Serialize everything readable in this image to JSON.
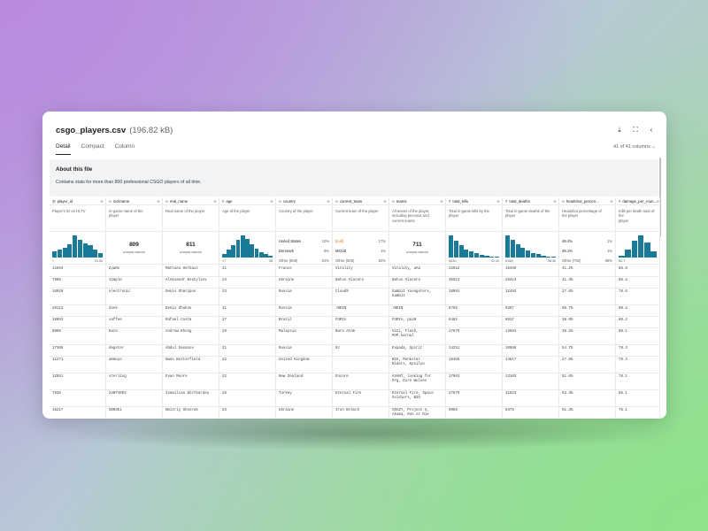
{
  "window": {
    "title": "csgo_players.csv",
    "size": "(196.82 kB)",
    "tabs": [
      "Detail",
      "Compact",
      "Column"
    ],
    "columns_info": "41 of 41 columns",
    "about_title": "About this file",
    "about_text": "Contains stats for more than 800 professional CSGO players of all time."
  },
  "colors": {
    "bar": "#1a7a97",
    "orange": "#e8710a"
  },
  "columns": [
    {
      "type_icon": "⊞",
      "name": "player_id",
      "desc": [
        "Player's ID on HLTV"
      ],
      "viz": "hist",
      "hist": [
        0.3,
        0.35,
        0.45,
        0.6,
        1.0,
        0.8,
        0.65,
        0.55,
        0.35,
        0.2
      ],
      "min": "7",
      "max": "20.5k",
      "cells": [
        "11893",
        "7998",
        "16920",
        "20113",
        "18053",
        "8098",
        "17306",
        "11271",
        "12951",
        "7938",
        "18217"
      ]
    },
    {
      "type_icon": "A",
      "name": "nickname",
      "desc": [
        "In-game name of the",
        "player"
      ],
      "viz": "unique",
      "unique_n": "809",
      "unique_label": "unique values",
      "cells": [
        "ZywOo",
        "s1mple",
        "electronic",
        "donk",
        "saffee",
        "Kaze",
        "degster",
        "ammoyo",
        "sterling",
        "XANTARES",
        "SENSEi"
      ]
    },
    {
      "type_icon": "A",
      "name": "real_name",
      "desc": [
        "Real name of the player"
      ],
      "viz": "unique",
      "unique_n": "811",
      "unique_label": "unique values",
      "cells": [
        "Mathieu Herbaut",
        "Aleksandr Kostyliev",
        "Denis Sharipov",
        "Denis Zhukov",
        "Rafael Costa",
        "Andrew Khong",
        "Abdul Gasanov",
        "Owen Butterfield",
        "Evan Moore",
        "İsmailcan Dörtkardeş",
        "Dmitriy Shvorak"
      ]
    },
    {
      "type_icon": "#",
      "name": "age",
      "desc": [
        "Age of the player"
      ],
      "viz": "hist",
      "hist": [
        0.15,
        0.35,
        0.55,
        0.8,
        1.0,
        0.85,
        0.6,
        0.4,
        0.25,
        0.15,
        0.08
      ],
      "min": "17",
      "max": "38",
      "cells": [
        "21",
        "24",
        "23",
        "21",
        "27",
        "29",
        "21",
        "22",
        "22",
        "26",
        "23"
      ]
    },
    {
      "type_icon": "A",
      "name": "country",
      "desc": [
        "Country of the player"
      ],
      "viz": "cats",
      "cats": [
        {
          "label": "United States",
          "pct": "10%"
        },
        {
          "label": "Denmark",
          "pct": "8%"
        },
        {
          "label": "Other (658)",
          "pct": "81%",
          "other": true
        }
      ],
      "cells": [
        "France",
        "Ukraine",
        "Russia",
        "Russia",
        "Brazil",
        "Malaysia",
        "Russia",
        "United Kingdom",
        "New Zealand",
        "Turkey",
        "Ukraine"
      ]
    },
    {
      "type_icon": "A",
      "name": "current_team",
      "desc": [
        "Current team of the player"
      ],
      "viz": "cats",
      "cats": [
        {
          "label": "[null]",
          "pct": "17%",
          "orange": true
        },
        {
          "label": "MOUZ",
          "pct": "1%"
        },
        {
          "label": "Other (509)",
          "pct": "82%",
          "other": true
        }
      ],
      "cells": [
        "Vitality",
        "Natus Vincere",
        "Cloud9",
        "!NEIN",
        "FURIA",
        "Bare Atom",
        "9z",
        "",
        "Encore",
        "Eternal Fire",
        "Iron Branch"
      ]
    },
    {
      "type_icon": "A",
      "name": "teams",
      "desc": [
        "All teams of the player,",
        "including previous and",
        "current teams"
      ],
      "viz": "unique",
      "unique_n": "711",
      "unique_label": "unique values",
      "cells": [
        [
          "Vitality, aAa"
        ],
        [
          "Natus Vincere"
        ],
        [
          "Gambit Youngsters,",
          "Gambit"
        ],
        [
          "!NEIN"
        ],
        [
          "FURIA, paiN"
        ],
        [
          "ViCi, Flash,",
          "MVP.karnal"
        ],
        [
          "Espada, Spirit"
        ],
        [
          "BIG, Monkstar",
          "Riders, Epsilon"
        ],
        [
          "AVANT, looking for",
          "Org, Dire Wolves"
        ],
        [
          "Eternal Fire, Space",
          "Soldiers, BIG"
        ],
        [
          "CRAZY, Project X,",
          "Akuma, Run or Die"
        ]
      ]
    },
    {
      "type_icon": "#",
      "name": "total_kills",
      "desc": [
        "Total in-game kills by the",
        "player"
      ],
      "viz": "hist",
      "hist": [
        1.0,
        0.75,
        0.55,
        0.38,
        0.28,
        0.2,
        0.12,
        0.08,
        0.05,
        0.03
      ],
      "min": "5530",
      "max": "41.2k",
      "cells": [
        "22922",
        "35512",
        "18091",
        "8759",
        "8482",
        "17679",
        "14251",
        "18466",
        "17963",
        "27879",
        "9969"
      ]
    },
    {
      "type_icon": "#",
      "name": "total_deaths",
      "desc": [
        "Total in-game deaths of the",
        "player"
      ],
      "viz": "hist",
      "hist": [
        1.0,
        0.8,
        0.6,
        0.45,
        0.32,
        0.22,
        0.15,
        0.1,
        0.06,
        0.03
      ],
      "min": "6168",
      "max": "38.3k",
      "cells": [
        "16459",
        "26413",
        "12492",
        "6397",
        "6517",
        "13584",
        "10988",
        "14617",
        "13103",
        "21623",
        "8379"
      ]
    },
    {
      "type_icon": "A",
      "name": "headshot_percen...",
      "desc": [
        "Headshot percentage of",
        "the player"
      ],
      "viz": "cats",
      "cats": [
        {
          "label": "48.4%",
          "pct": "1%"
        },
        {
          "label": "49.1%",
          "pct": "1%"
        },
        {
          "label": "Other (792)",
          "pct": "98%",
          "other": true
        }
      ],
      "cells": [
        "41.2%",
        "41.3%",
        "27.8%",
        "50.7%",
        "38.9%",
        "38.2%",
        "54.7%",
        "27.8%",
        "51.6%",
        "53.3%",
        "51.3%"
      ]
    },
    {
      "type_icon": "#",
      "name": "damage_per_roun...",
      "desc": [
        "Kills per death ratio of the",
        "player"
      ],
      "viz": "hist",
      "hist": [
        0.1,
        0.35,
        0.75,
        1.0,
        0.7,
        0.3
      ],
      "min": "60.7",
      "max": "",
      "cells": [
        "86.8",
        "86.4",
        "78.6",
        "90.4",
        "80.2",
        "80.1",
        "79.3",
        "79.3",
        "78.1",
        "85.1",
        "76.1"
      ]
    }
  ]
}
